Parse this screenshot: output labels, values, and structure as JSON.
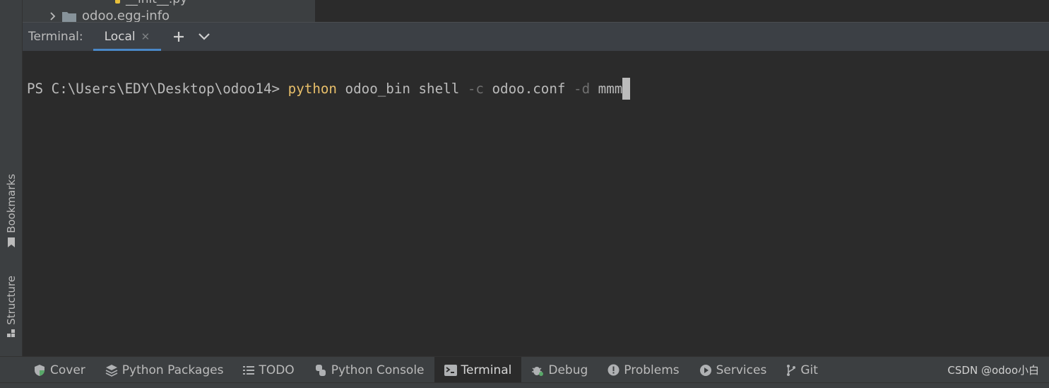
{
  "project_tree": {
    "prev_row_label": "__init__.py",
    "row_label": "odoo.egg-info"
  },
  "left_stripe": {
    "bookmarks_label": "Bookmarks",
    "structure_label": "Structure"
  },
  "terminal": {
    "title": "Terminal:",
    "tabs": [
      {
        "label": "Local"
      }
    ],
    "prompt": "PS C:\\Users\\EDY\\Desktop\\odoo14> ",
    "command": {
      "executable": "python",
      "arg1": " odoo_bin shell ",
      "flag_c": "-c",
      "arg2": " odoo.conf ",
      "flag_d": "-d",
      "arg3": " mmm"
    }
  },
  "tool_windows": [
    {
      "label": "Cover"
    },
    {
      "label": "Python Packages"
    },
    {
      "label": "TODO"
    },
    {
      "label": "Python Console"
    },
    {
      "label": "Terminal"
    },
    {
      "label": "Debug"
    },
    {
      "label": "Problems"
    },
    {
      "label": "Services"
    },
    {
      "label": "Git"
    }
  ],
  "watermark": "CSDN @odoo小白",
  "colors": {
    "background": "#2b2b2b",
    "panel": "#3c3f41",
    "accent": "#4a88c7",
    "keyword": "#e8bf6a"
  }
}
